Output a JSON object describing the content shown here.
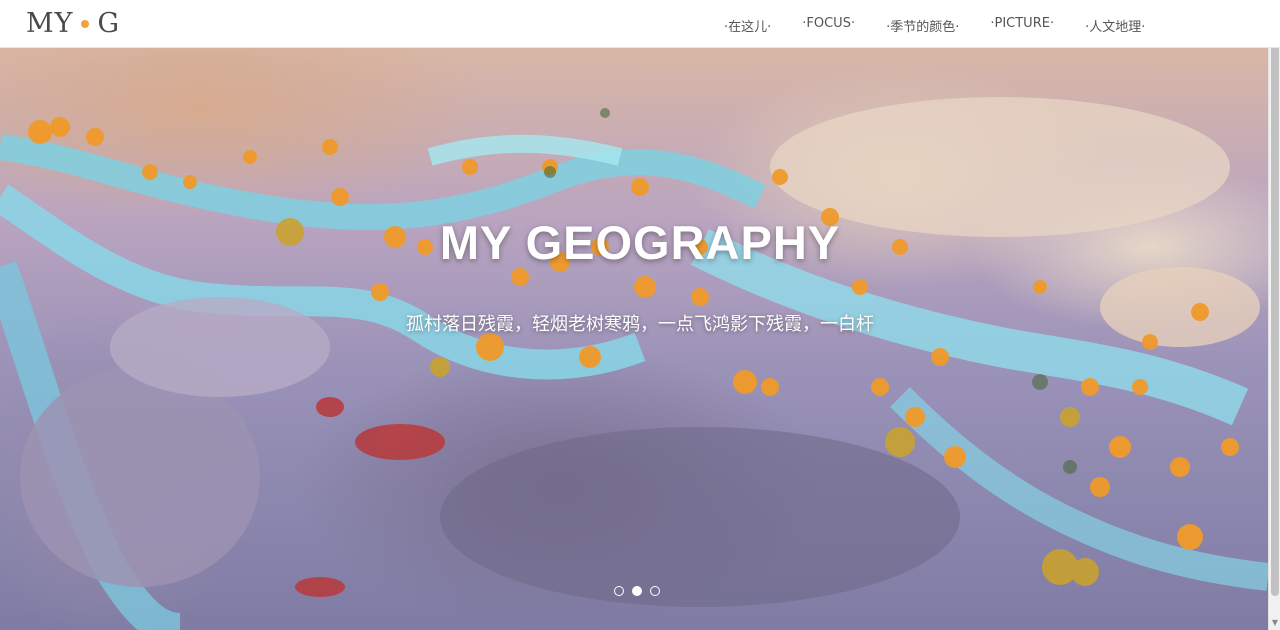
{
  "header": {
    "logo_left": "MY",
    "logo_right": "G",
    "nav": [
      "·在这儿·",
      "·FOCUS·",
      "·季节的颜色·",
      "·PICTURE·",
      "·人文地理·"
    ]
  },
  "hero": {
    "title": "MY GEOGRAPHY",
    "subtitle": "孤村落日残霞，轻烟老树寒鸦，一点飞鸿影下残霞，一白杆"
  },
  "carousel": {
    "active_index": 1,
    "slide_count": 3
  },
  "colors": {
    "accent": "#f2a23a",
    "text": "#555555"
  }
}
